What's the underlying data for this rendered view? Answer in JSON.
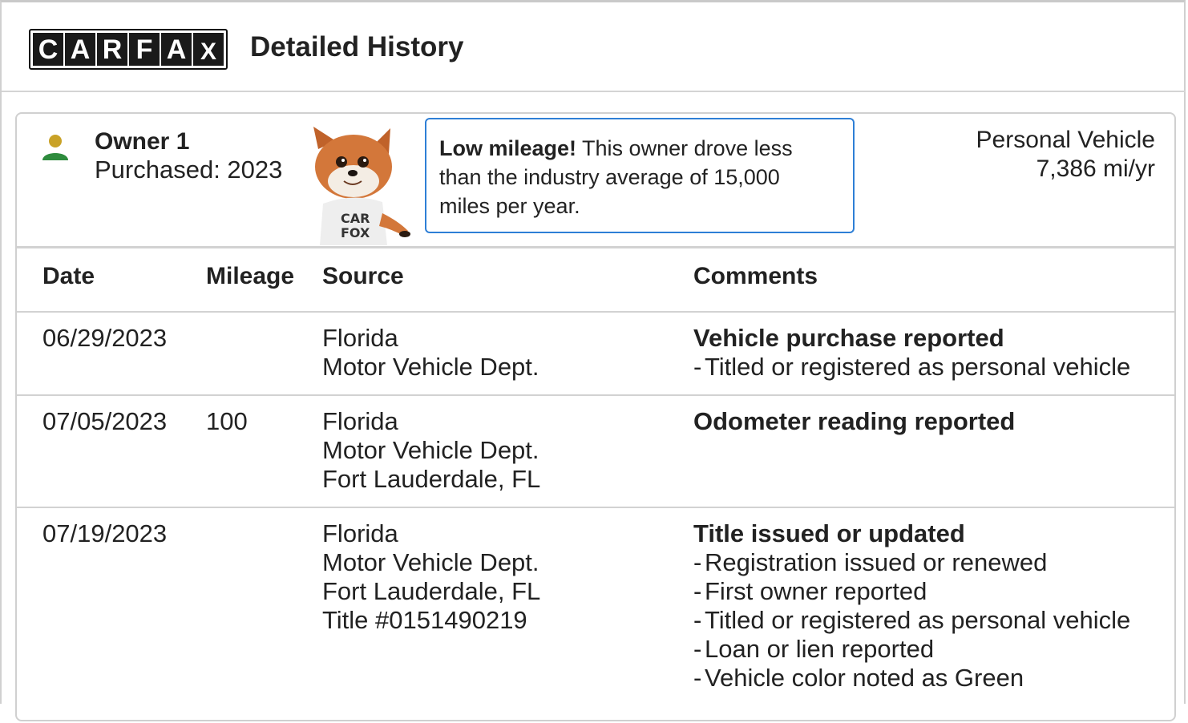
{
  "brand": {
    "logo_letters": [
      "C",
      "A",
      "R",
      "F",
      "A",
      "X"
    ],
    "title": "Detailed History"
  },
  "owner": {
    "name": "Owner 1",
    "purchased": "Purchased: 2023",
    "vehicle_type": "Personal Vehicle",
    "miles_per_year": "7,386 mi/yr",
    "callout_bold": "Low mileage!",
    "callout_lines": [
      "This owner drove less",
      "than the industry average of 15,000",
      "miles per year."
    ],
    "mascot_shirt_text": "CAR FOX",
    "colors": {
      "owner_icon_head": "#c9a227",
      "owner_icon_body": "#2e8b3d",
      "callout_border": "#2e7fd6"
    }
  },
  "table": {
    "headers": {
      "date": "Date",
      "mileage": "Mileage",
      "source": "Source",
      "comments": "Comments"
    },
    "rows": [
      {
        "date": "06/29/2023",
        "mileage": "",
        "source": [
          "Florida",
          "Motor Vehicle Dept."
        ],
        "comment_title": "Vehicle purchase reported",
        "comment_items": [
          "Titled or registered as personal vehicle"
        ]
      },
      {
        "date": "07/05/2023",
        "mileage": "100",
        "source": [
          "Florida",
          "Motor Vehicle Dept.",
          "Fort Lauderdale, FL"
        ],
        "comment_title": "Odometer reading reported",
        "comment_items": []
      },
      {
        "date": "07/19/2023",
        "mileage": "",
        "source": [
          "Florida",
          "Motor Vehicle Dept.",
          "Fort Lauderdale, FL",
          "Title #0151490219"
        ],
        "comment_title": "Title issued or updated",
        "comment_items": [
          "Registration issued or renewed",
          "First owner reported",
          "Titled or registered as personal vehicle",
          "Loan or lien reported",
          "Vehicle color noted as Green"
        ]
      }
    ]
  }
}
